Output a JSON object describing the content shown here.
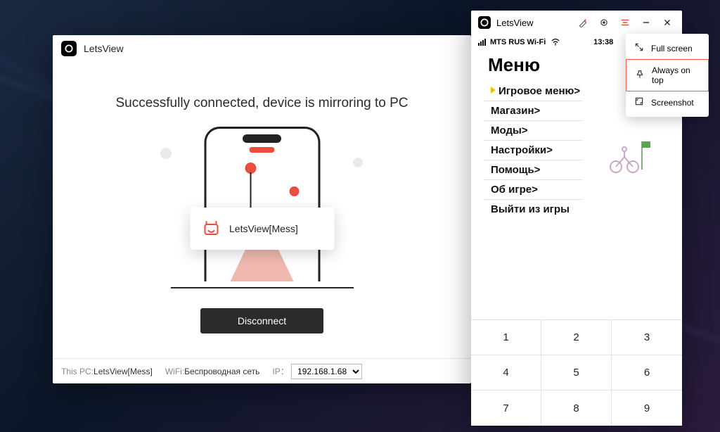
{
  "mainWindow": {
    "title": "LetsView",
    "headline": "Successfully connected, device is mirroring to PC",
    "castDeviceName": "LetsView[Mess]",
    "disconnectLabel": "Disconnect",
    "status": {
      "thisPcLabel": "This PC:",
      "thisPcValue": "LetsView[Mess]",
      "wifiLabel": "WiFi:",
      "wifiValue": "Беспроводная сеть",
      "ipLabel": "IP：",
      "ipValue": "192.168.1.68"
    }
  },
  "deviceWindow": {
    "title": "LetsView",
    "phoneStatus": {
      "carrier": "MTS RUS Wi-Fi",
      "time": "13:38"
    },
    "menuTitle": "Меню",
    "menuItems": [
      {
        "label": "Игровое меню>",
        "active": true
      },
      {
        "label": "Магазин>"
      },
      {
        "label": "Моды>"
      },
      {
        "label": "Настройки>"
      },
      {
        "label": "Помощь>"
      },
      {
        "label": "Об игре>"
      },
      {
        "label": "Выйти из игры",
        "noborder": true
      }
    ],
    "keypad": [
      "1",
      "2",
      "3",
      "4",
      "5",
      "6",
      "7",
      "8",
      "9"
    ]
  },
  "popup": {
    "items": [
      {
        "icon": "fullscreen",
        "label": "Full screen"
      },
      {
        "icon": "pin",
        "label": "Always on top",
        "highlighted": true
      },
      {
        "icon": "screenshot",
        "label": "Screenshot"
      }
    ]
  }
}
